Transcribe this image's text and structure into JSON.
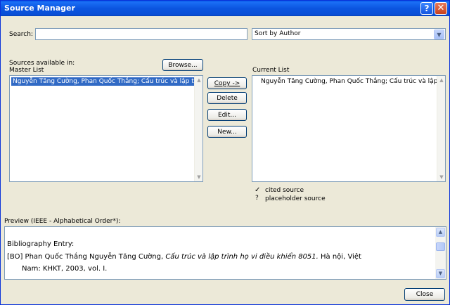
{
  "window": {
    "title": "Source Manager",
    "help_glyph": "?",
    "close_glyph": "✕"
  },
  "search": {
    "label": "Search:",
    "value": "",
    "sort_value": "Sort by Author"
  },
  "master": {
    "sources_label": "Sources available in:",
    "list_label": "Master List",
    "browse_label": "Browse...",
    "items": [
      "Nguyễn Tăng Cường, Phan Quốc Thắng; Cấu trúc và lập trình họ vi đi"
    ]
  },
  "actions": {
    "copy": "Copy ->",
    "delete": "Delete",
    "edit": "Edit...",
    "new": "New..."
  },
  "current": {
    "list_label": "Current List",
    "items": [
      "Nguyễn Tăng Cường, Phan Quốc Thắng; Cấu trúc và lập trình họ vi đi"
    ]
  },
  "legend": {
    "cited_mark": "✓",
    "cited_label": "cited source",
    "placeholder_mark": "?",
    "placeholder_label": "placeholder source"
  },
  "preview": {
    "label": "Preview (IEEE - Alphabetical Order*):",
    "heading": "Bibliography Entry:",
    "entry_prefix": "[BO] Phan Quốc Thắng Nguyễn Tăng Cường, ",
    "entry_title": "Cấu trúc và lập trình họ vi điều khiển 8051.",
    "entry_suffix": " Hà nội, Việt",
    "entry_line2": "Nam: KHKT, 2003, vol. I."
  },
  "footer": {
    "close_label": "Close"
  },
  "colors": {
    "titlebar": "#0a5ce8",
    "dialog_bg": "#ece9d8",
    "selection": "#316ac5"
  }
}
